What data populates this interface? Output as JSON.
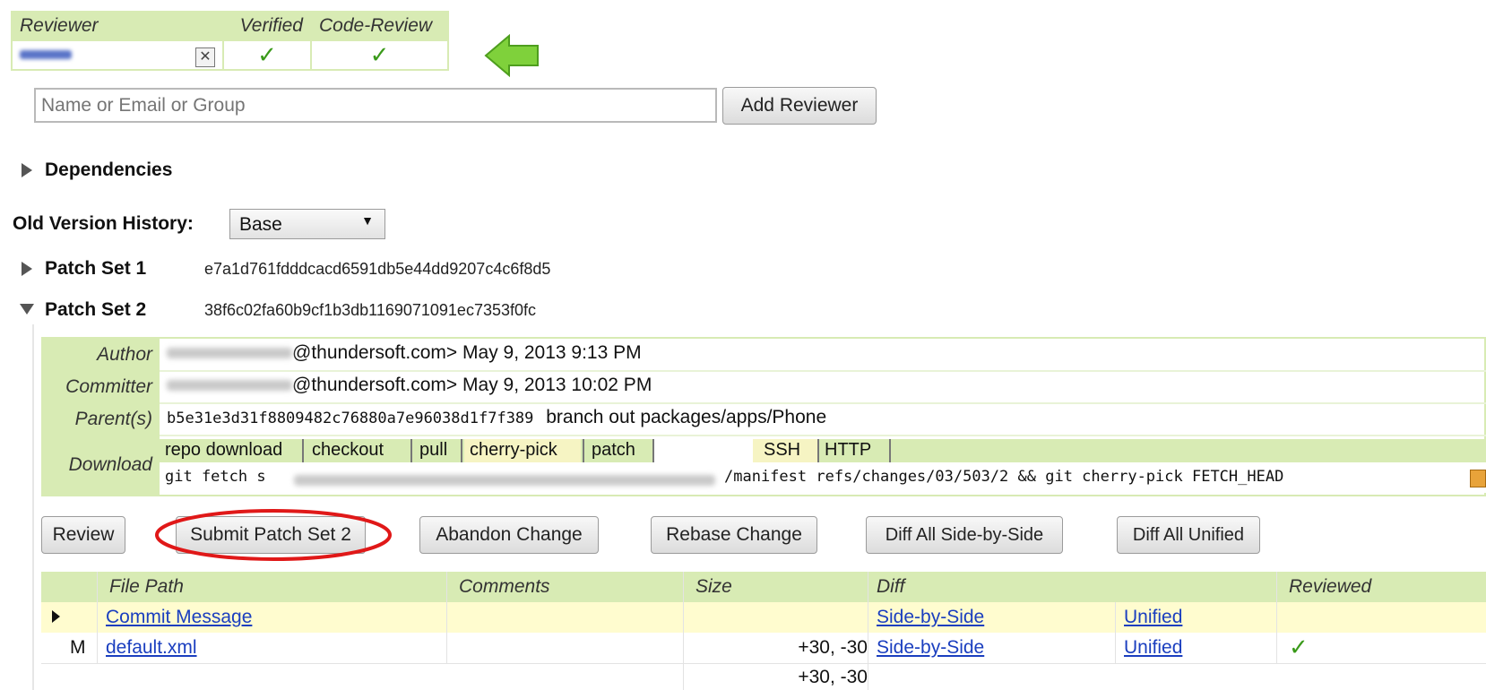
{
  "reviewers": {
    "headers": [
      "Reviewer",
      "Verified",
      "Code-Review"
    ],
    "rows": [
      {
        "verified": "✓",
        "code_review": "✓",
        "remove": "✕"
      }
    ]
  },
  "add_reviewer": {
    "placeholder": "Name or Email or Group",
    "button": "Add Reviewer"
  },
  "dependencies": "Dependencies",
  "old_version": {
    "label": "Old Version History:",
    "selected": "Base"
  },
  "patch_sets": [
    {
      "label": "Patch Set 1",
      "hash": "e7a1d761fdddcacd6591db5e44dd9207c4c6f8d5"
    },
    {
      "label": "Patch Set 2",
      "hash": "38f6c02fa60b9cf1b3db1169071091ec7353f0fc"
    }
  ],
  "commit_info": {
    "author_label": "Author",
    "author_email": "@thundersoft.com>",
    "author_date": "May 9, 2013 9:13 PM",
    "committer_label": "Committer",
    "committer_email": "@thundersoft.com>",
    "committer_date": "May 9, 2013 10:02 PM",
    "parent_label": "Parent(s)",
    "parent_hash": "b5e31e3d31f8809482c76880a7e96038d1f7f389",
    "parent_msg": "branch out packages/apps/Phone",
    "download_label": "Download",
    "download_tabs": [
      "repo download",
      "checkout",
      "pull",
      "cherry-pick",
      "patch"
    ],
    "protocols": [
      "SSH",
      "HTTP"
    ],
    "cmd_start": "git fetch s",
    "cmd_end": "/manifest refs/changes/03/503/2 && git cherry-pick FETCH_HEAD"
  },
  "actions": [
    "Review",
    "Submit Patch Set 2",
    "Abandon Change",
    "Rebase Change",
    "Diff All Side-by-Side",
    "Diff All Unified"
  ],
  "files": {
    "headers": [
      "File Path",
      "Comments",
      "Size",
      "Diff",
      "Reviewed"
    ],
    "rows": [
      {
        "status": "",
        "path": "Commit Message",
        "size": "",
        "side": "Side-by-Side",
        "unified": "Unified",
        "reviewed": ""
      },
      {
        "status": "M",
        "path": "default.xml",
        "size": "+30, -30",
        "side": "Side-by-Side",
        "unified": "Unified",
        "reviewed": "✓"
      }
    ],
    "total": "+30, -30"
  },
  "colors": {
    "header_green": "#d8ebb4",
    "highlight_yellow": "#fffccf",
    "arrow_green": "#7fd13b",
    "circle_red": "#e01818"
  }
}
